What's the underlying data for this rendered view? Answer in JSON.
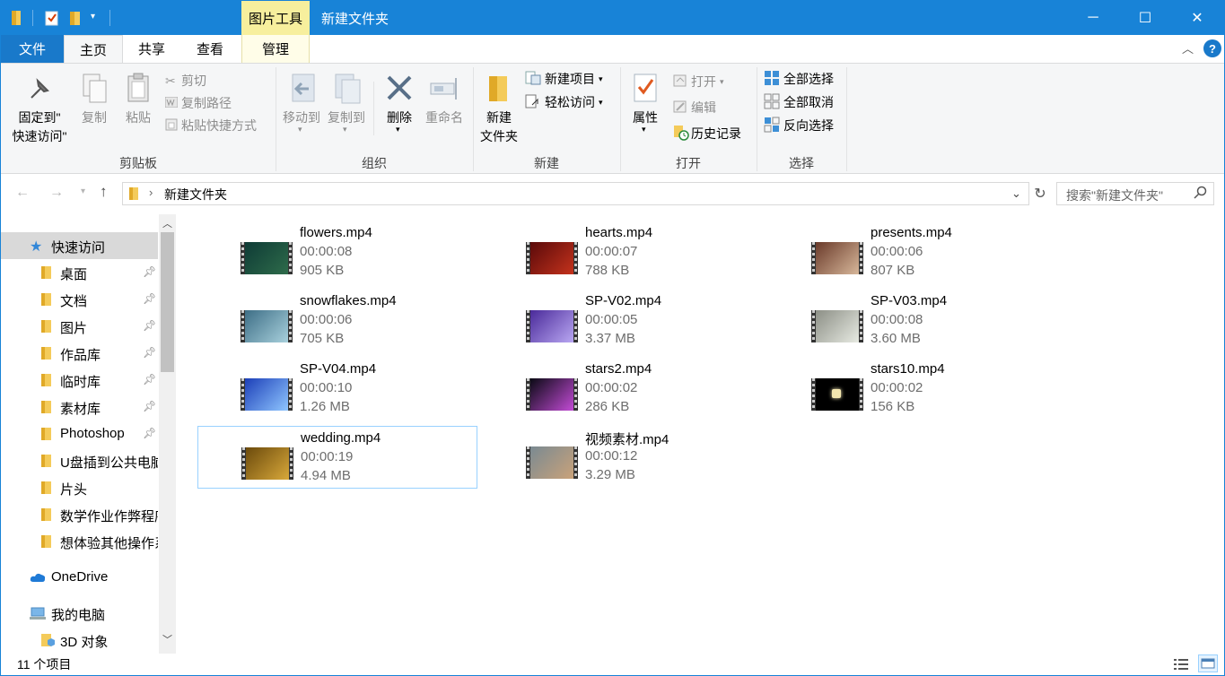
{
  "titlebar": {
    "context_tab": "图片工具",
    "title": "新建文件夹",
    "minimize_glyph": "─",
    "maximize_glyph": "☐",
    "close_glyph": "✕"
  },
  "tabs": {
    "file": "文件",
    "home": "主页",
    "share": "共享",
    "view": "查看",
    "manage": "管理"
  },
  "ribbon": {
    "pin_quick_line1": "固定到\"",
    "pin_quick_line2": "快速访问\"",
    "copy": "复制",
    "paste": "粘贴",
    "cut": "剪切",
    "copy_path": "复制路径",
    "paste_shortcut": "粘贴快捷方式",
    "group_clipboard": "剪贴板",
    "move_to": "移动到",
    "copy_to": "复制到",
    "delete": "删除",
    "rename": "重命名",
    "group_organize": "组织",
    "new_folder_line1": "新建",
    "new_folder_line2": "文件夹",
    "new_item": "新建项目",
    "easy_access": "轻松访问",
    "group_new": "新建",
    "properties": "属性",
    "open": "打开",
    "edit": "编辑",
    "history": "历史记录",
    "group_open": "打开",
    "select_all": "全部选择",
    "select_none": "全部取消",
    "invert_selection": "反向选择",
    "group_select": "选择"
  },
  "address": {
    "path": "新建文件夹",
    "search_placeholder": "搜索\"新建文件夹\""
  },
  "navpane": {
    "quick_access": "快速访问",
    "items": [
      {
        "label": "桌面",
        "pinned": true
      },
      {
        "label": "文档",
        "pinned": true
      },
      {
        "label": "图片",
        "pinned": true
      },
      {
        "label": "作品库",
        "pinned": true
      },
      {
        "label": "临时库",
        "pinned": true
      },
      {
        "label": "素材库",
        "pinned": true
      },
      {
        "label": "Photoshop",
        "pinned": true
      },
      {
        "label": "U盘插到公共电脑",
        "pinned": false
      },
      {
        "label": "片头",
        "pinned": false
      },
      {
        "label": "数学作业作弊程序",
        "pinned": false
      },
      {
        "label": "想体验其他操作系统",
        "pinned": false
      }
    ],
    "onedrive": "OneDrive",
    "this_pc": "我的电脑",
    "objects_3d": "3D 对象"
  },
  "files": [
    {
      "name": "flowers.mp4",
      "duration": "00:00:08",
      "size": "905 KB",
      "thumb": [
        "#0e3b36",
        "#2e6b4a"
      ]
    },
    {
      "name": "hearts.mp4",
      "duration": "00:00:07",
      "size": "788 KB",
      "thumb": [
        "#5a0a0a",
        "#c4321c"
      ]
    },
    {
      "name": "presents.mp4",
      "duration": "00:00:06",
      "size": "807 KB",
      "thumb": [
        "#6a3a2a",
        "#d7b79a"
      ]
    },
    {
      "name": "snowflakes.mp4",
      "duration": "00:00:06",
      "size": "705 KB",
      "thumb": [
        "#3d6e86",
        "#a8d0dc"
      ]
    },
    {
      "name": "SP-V02.mp4",
      "duration": "00:00:05",
      "size": "3.37 MB",
      "thumb": [
        "#4a2a9a",
        "#b9a7f2"
      ]
    },
    {
      "name": "SP-V03.mp4",
      "duration": "00:00:08",
      "size": "3.60 MB",
      "thumb": [
        "#8c8f86",
        "#e7eae2"
      ]
    },
    {
      "name": "SP-V04.mp4",
      "duration": "00:00:10",
      "size": "1.26 MB",
      "thumb": [
        "#1c3fb8",
        "#8fc6ff"
      ]
    },
    {
      "name": "stars2.mp4",
      "duration": "00:00:02",
      "size": "286 KB",
      "thumb": [
        "#0a0a14",
        "#c34bd6"
      ]
    },
    {
      "name": "stars10.mp4",
      "duration": "00:00:02",
      "size": "156 KB",
      "thumb": [
        "#000000",
        "#000000"
      ]
    },
    {
      "name": "wedding.mp4",
      "duration": "00:00:19",
      "size": "4.94 MB",
      "thumb": [
        "#6b4a0c",
        "#d8a83a"
      ]
    },
    {
      "name": "视频素材.mp4",
      "duration": "00:00:12",
      "size": "3.29 MB",
      "thumb": [
        "#7a8a92",
        "#c9a27a"
      ]
    }
  ],
  "status": {
    "item_count": "11 个项目"
  },
  "colors": {
    "titlebar": "#1883d7",
    "file_tab": "#1979ca",
    "context_tab": "#f7ef9d",
    "selection_border": "#99d1ff"
  }
}
